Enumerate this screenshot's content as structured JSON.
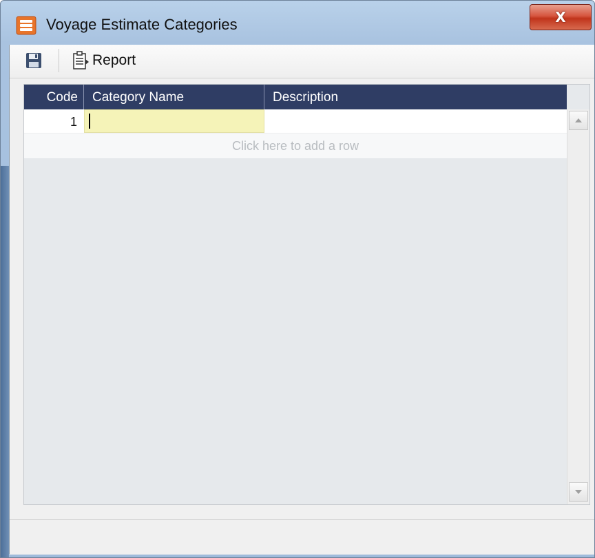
{
  "window": {
    "title": "Voyage Estimate Categories",
    "close_label": "X"
  },
  "toolbar": {
    "save_icon": "save-icon",
    "report_label": "Report"
  },
  "grid": {
    "columns": [
      "Code",
      "Category Name",
      "Description"
    ],
    "rows": [
      {
        "code": "1",
        "category_name": "",
        "description": ""
      }
    ],
    "add_row_text": "Click here to add a row"
  },
  "colors": {
    "header_bg": "#2f3d64",
    "active_cell_bg": "#f5f3b8",
    "close_button": "#c0341b"
  }
}
